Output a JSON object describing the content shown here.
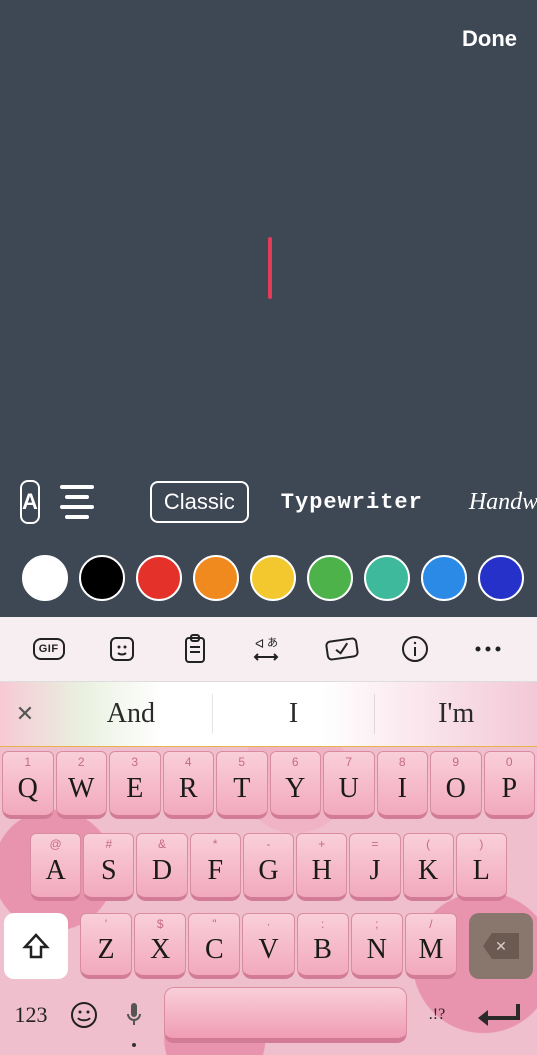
{
  "header": {
    "done": "Done"
  },
  "font_styles": [
    {
      "id": "classic",
      "label": "Classic",
      "selected": true,
      "class": ""
    },
    {
      "id": "typewriter",
      "label": "Typewriter",
      "selected": false,
      "class": "typewriter"
    },
    {
      "id": "handwriting",
      "label": "Handwri",
      "selected": false,
      "class": "handwrite"
    }
  ],
  "colors": [
    "#ffffff",
    "#000000",
    "#e4322b",
    "#f08a1f",
    "#f3c82f",
    "#4db24a",
    "#3fb99b",
    "#2b8ae6",
    "#2531c8"
  ],
  "keyboard": {
    "toolbar": [
      "gif",
      "sticker",
      "clipboard",
      "translate",
      "check",
      "info",
      "more"
    ],
    "suggestions": [
      "And",
      "I",
      "I'm"
    ],
    "row1": [
      {
        "m": "Q",
        "a": "1"
      },
      {
        "m": "W",
        "a": "2"
      },
      {
        "m": "E",
        "a": "3"
      },
      {
        "m": "R",
        "a": "4"
      },
      {
        "m": "T",
        "a": "5"
      },
      {
        "m": "Y",
        "a": "6"
      },
      {
        "m": "U",
        "a": "7"
      },
      {
        "m": "I",
        "a": "8"
      },
      {
        "m": "O",
        "a": "9"
      },
      {
        "m": "P",
        "a": "0"
      }
    ],
    "row2": [
      {
        "m": "A",
        "a": "@"
      },
      {
        "m": "S",
        "a": "#"
      },
      {
        "m": "D",
        "a": "&"
      },
      {
        "m": "F",
        "a": "*"
      },
      {
        "m": "G",
        "a": "-"
      },
      {
        "m": "H",
        "a": "+"
      },
      {
        "m": "J",
        "a": "="
      },
      {
        "m": "K",
        "a": "("
      },
      {
        "m": "L",
        "a": ")"
      }
    ],
    "row3": [
      {
        "m": "Z",
        "a": "'"
      },
      {
        "m": "X",
        "a": "$"
      },
      {
        "m": "C",
        "a": "\""
      },
      {
        "m": "V",
        "a": "·"
      },
      {
        "m": "B",
        "a": ":"
      },
      {
        "m": "N",
        "a": ";"
      },
      {
        "m": "M",
        "a": "/"
      }
    ],
    "numKey": "123",
    "punctKey": ".!?"
  }
}
